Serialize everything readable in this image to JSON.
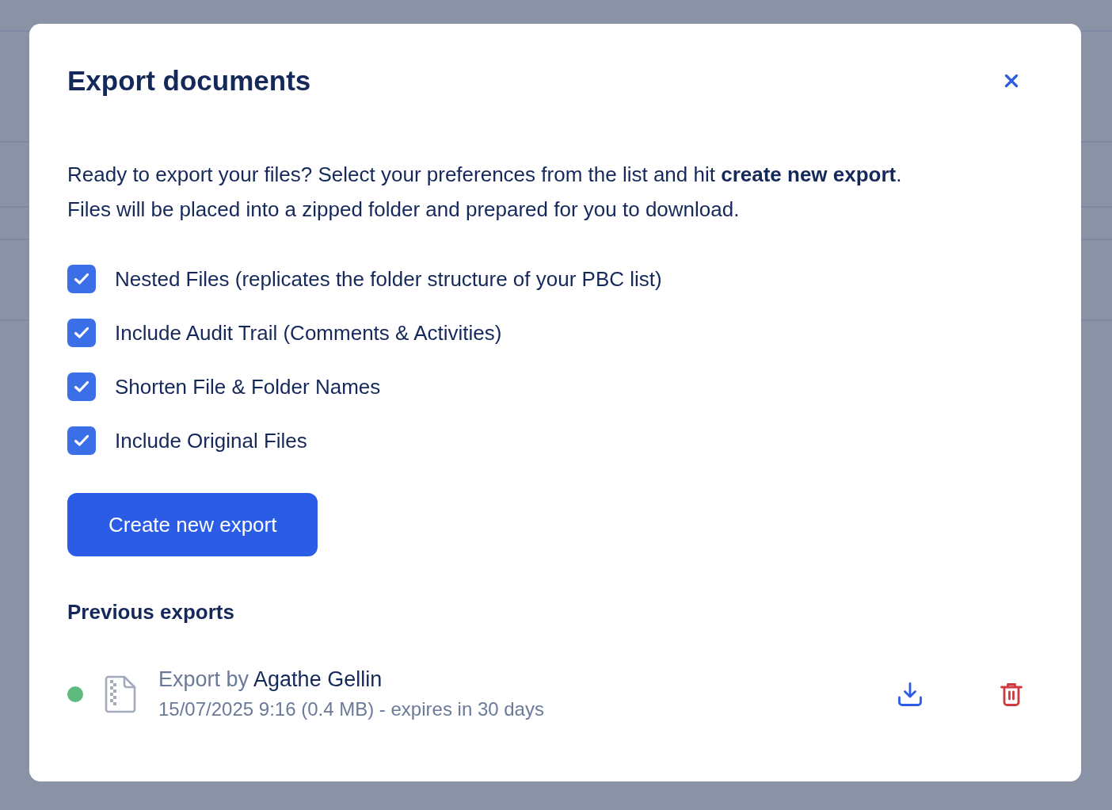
{
  "dialog": {
    "title": "Export documents",
    "intro": [
      "Ready to export your files? Select your preferences from the list and hit **create new export**.",
      "Files will be placed into a zipped folder and prepared for you to download."
    ],
    "options": [
      {
        "label": "Nested Files (replicates the folder structure of your PBC list)",
        "checked": true
      },
      {
        "label": "Include Audit Trail (Comments & Activities)",
        "checked": true
      },
      {
        "label": "Shorten File & Folder Names",
        "checked": true
      },
      {
        "label": "Include Original Files",
        "checked": true
      }
    ],
    "create_button": "Create new export",
    "previous_exports": {
      "heading": "Previous exports",
      "items": [
        {
          "color": "#5fba7d",
          "title": "Export by **Agathe Gellin**",
          "details": "15/07/2025 9:16 (0.4 MB) - expires in 30 days"
        }
      ]
    }
  }
}
